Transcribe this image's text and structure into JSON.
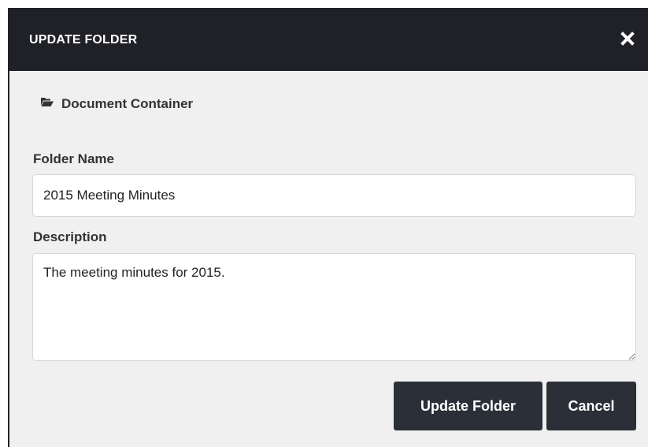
{
  "dialog": {
    "title": "UPDATE FOLDER",
    "close_icon": "close-icon"
  },
  "breadcrumb": {
    "icon": "folder-open-icon",
    "label": "Document Container"
  },
  "form": {
    "folder_name": {
      "label": "Folder Name",
      "value": "2015 Meeting Minutes"
    },
    "description": {
      "label": "Description",
      "value": "The meeting minutes for 2015."
    }
  },
  "actions": {
    "update_label": "Update Folder",
    "cancel_label": "Cancel"
  },
  "colors": {
    "header_bg": "#1f2126",
    "body_bg": "#f0f0f0",
    "button_bg": "#2a2f38"
  }
}
